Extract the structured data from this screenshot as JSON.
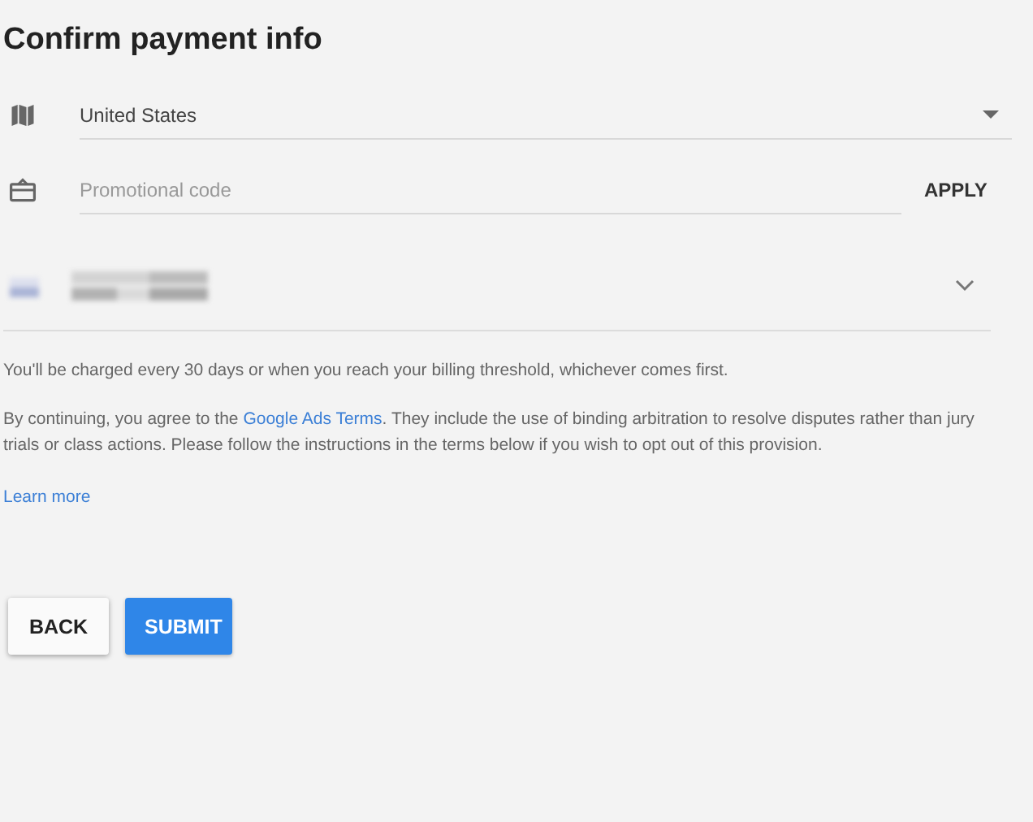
{
  "title": "Confirm payment info",
  "country": {
    "value": "United States"
  },
  "promo": {
    "placeholder": "Promotional code",
    "action": "APPLY"
  },
  "payment_method": {
    "expanded": false
  },
  "billing_note": "You'll be charged every 30 days or when you reach your billing threshold, whichever comes first.",
  "terms": {
    "before": "By continuing, you agree to the ",
    "link": "Google Ads Terms",
    "after": ". They include the use of binding arbitration to resolve disputes rather than jury trials or class actions. Please follow the instructions in the terms below if you wish to opt out of this provision.",
    "learn_more": "Learn more"
  },
  "buttons": [
    {
      "label": "BACK",
      "kind": "secondary"
    },
    {
      "label": "SUBMIT",
      "kind": "primary"
    }
  ]
}
